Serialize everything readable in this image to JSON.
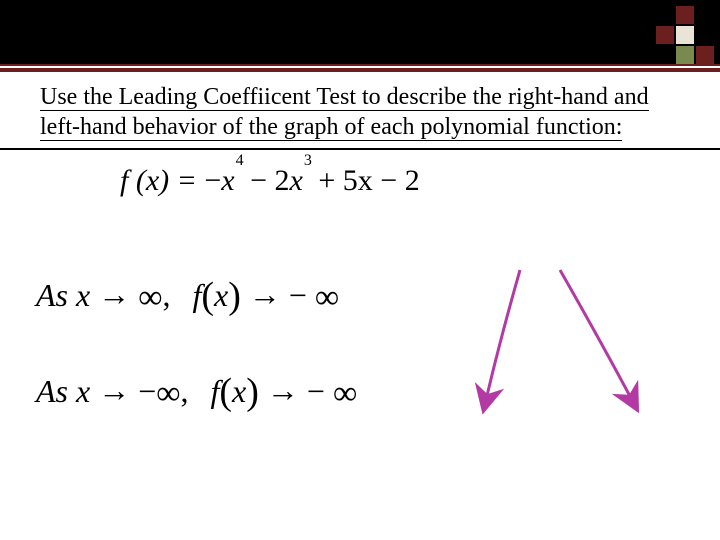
{
  "title": {
    "text": "Use the Leading Coeffiicent Test to describe the right-hand and left-hand behavior of the graph of each polynomial function:"
  },
  "equation": {
    "f_lhs": "f (x) = ",
    "term1_sign": "−",
    "term1_var": "x",
    "term1_exp": "4",
    "term2_sign": " − 2",
    "term2_var": "x",
    "term2_exp": "3",
    "term3": " + 5x − 2"
  },
  "limits": [
    {
      "as": "As  x",
      "arrow": " → ",
      "xval_sign": "",
      "xval": "∞",
      "comma": ",",
      "f": "f",
      "lp": "(",
      "xarg": "x",
      "rp": ")",
      "rarrow": " → ",
      "res_sign": "− ",
      "res": "∞"
    },
    {
      "as": "As  x",
      "arrow": " → ",
      "xval_sign": "−",
      "xval": "∞",
      "comma": ",",
      "f": "f",
      "lp": "(",
      "xarg": "x",
      "rp": ")",
      "rarrow": " → ",
      "res_sign": "− ",
      "res": "∞"
    }
  ]
}
